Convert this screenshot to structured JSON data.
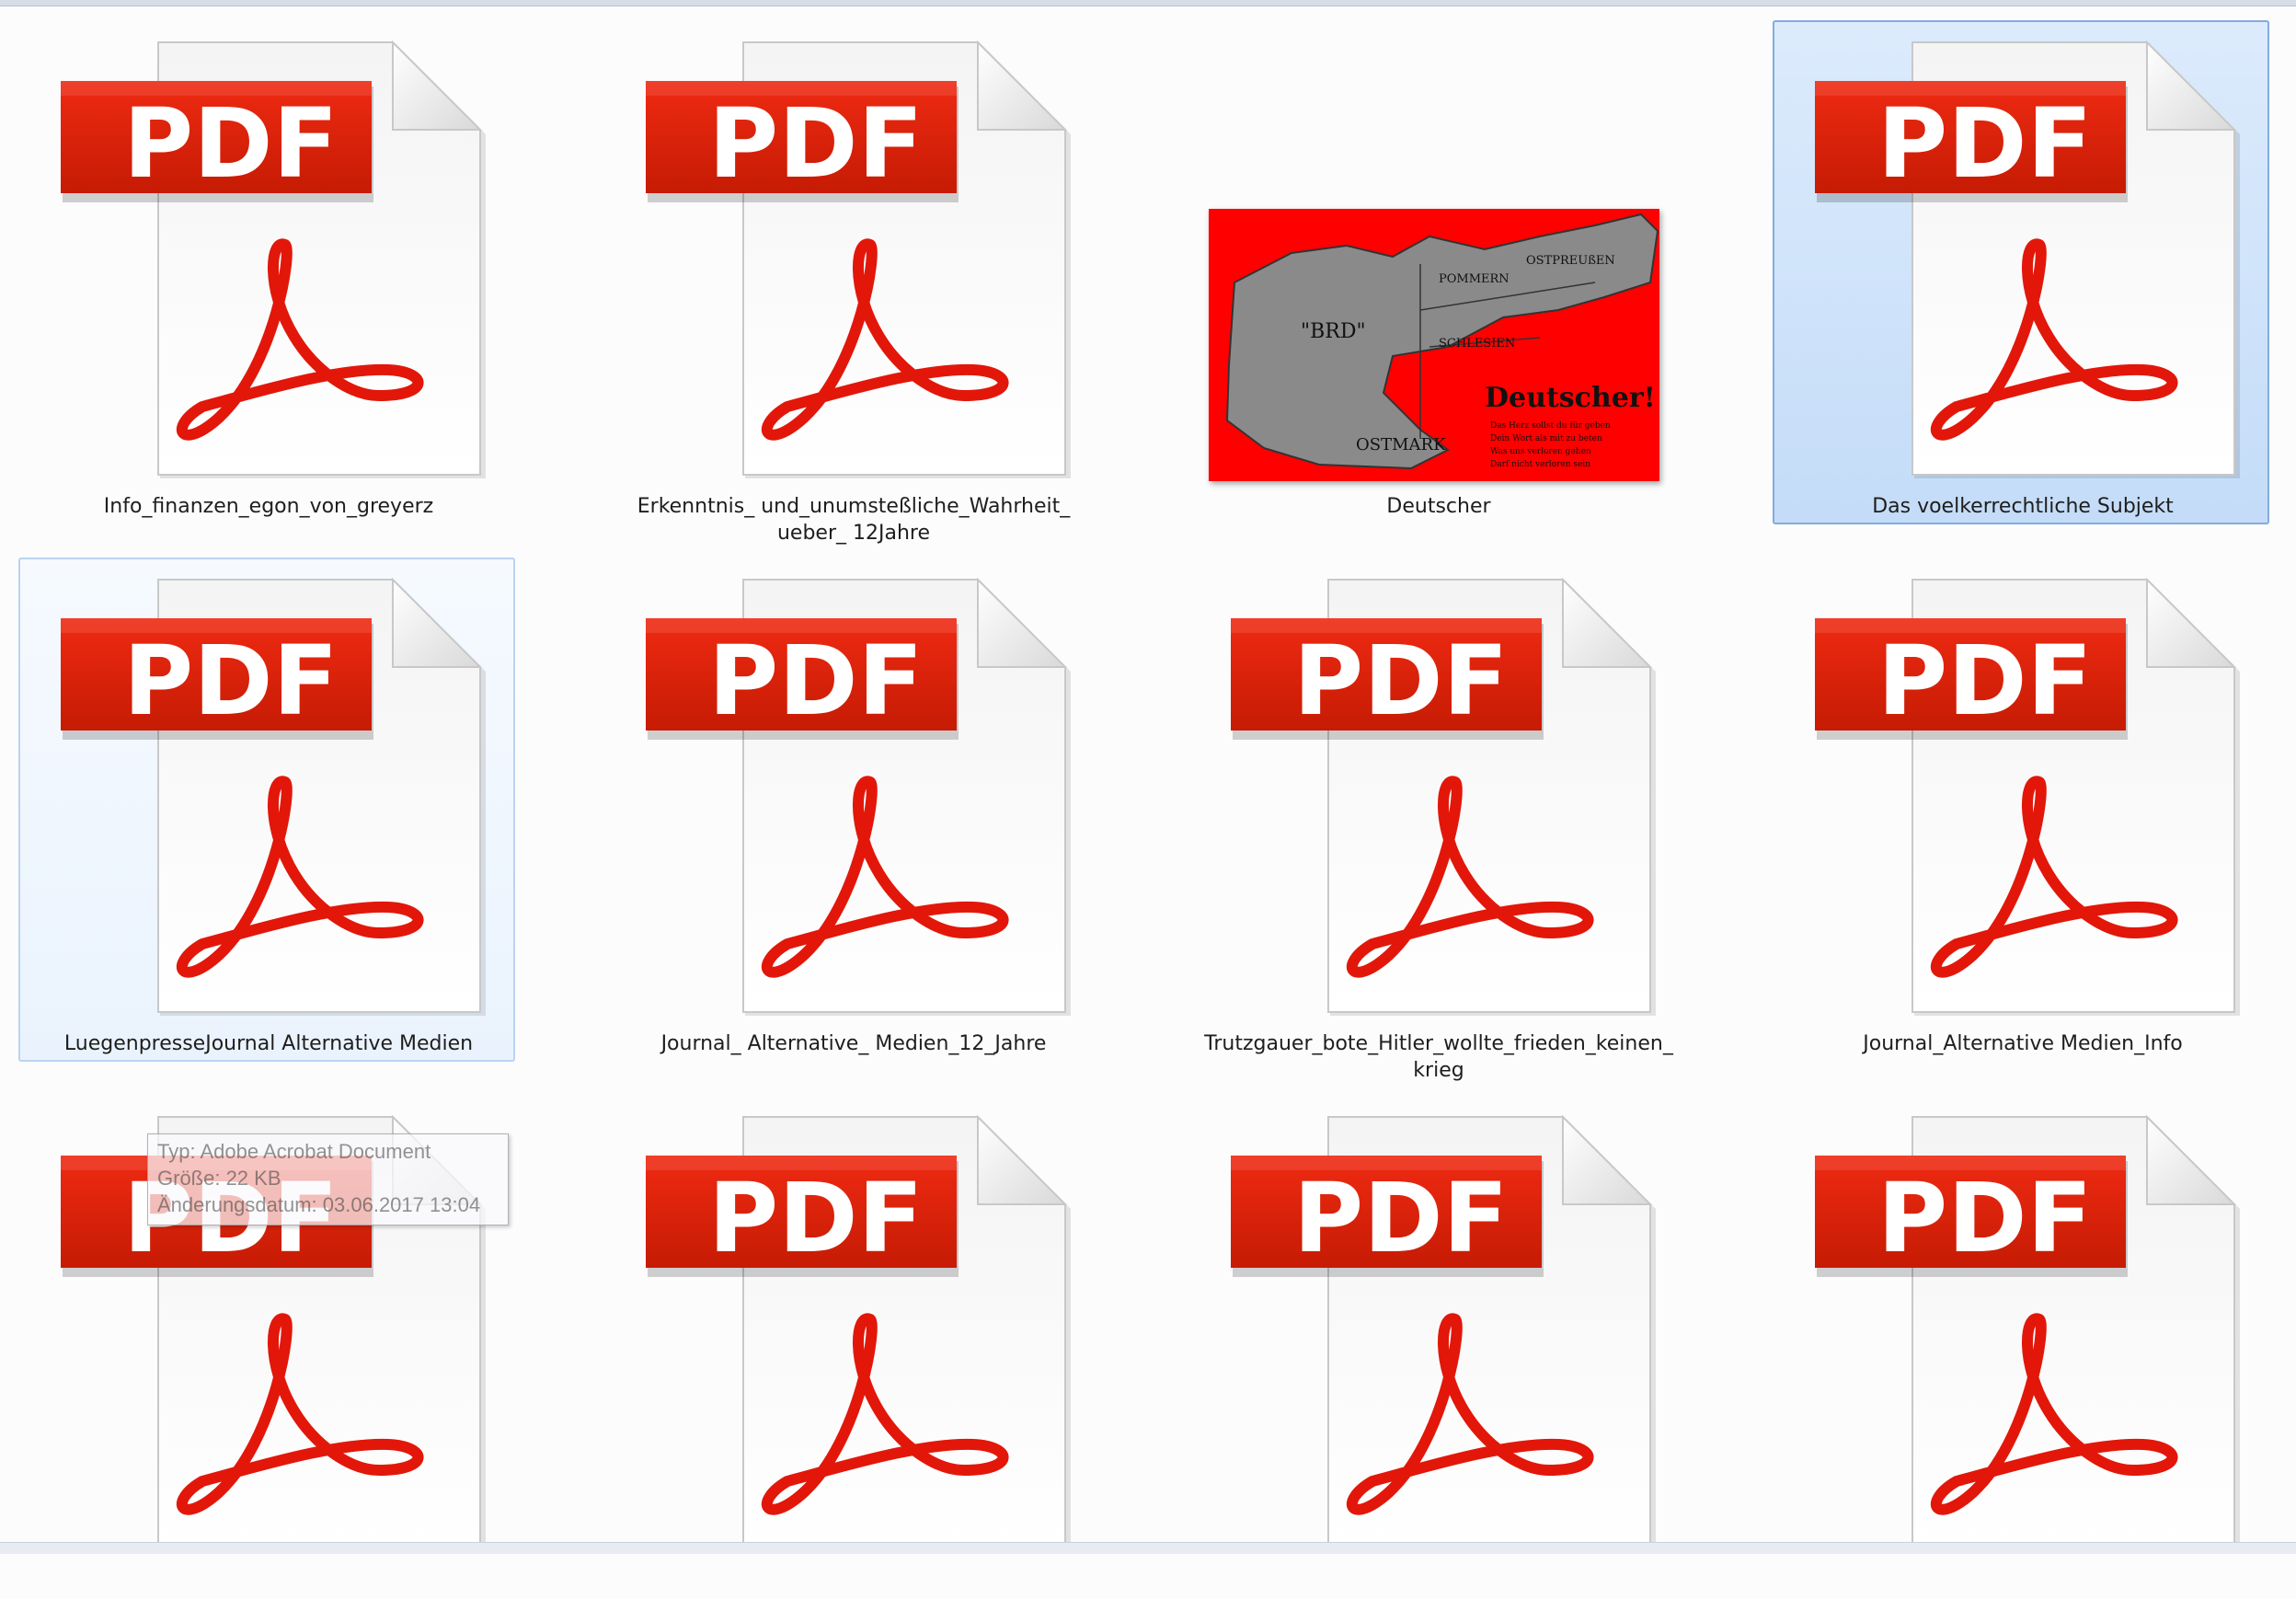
{
  "files": [
    {
      "name": "Info_finanzen_egon_von_greyerz",
      "type": "pdf",
      "state": "normal"
    },
    {
      "name": "Erkenntnis_ und_unumsteßliche_Wahrheit_ ueber_ 12Jahre",
      "type": "pdf",
      "state": "normal"
    },
    {
      "name": "Deutscher",
      "type": "image",
      "state": "normal"
    },
    {
      "name": "Das voelkerrechtliche Subjekt",
      "type": "pdf",
      "state": "selected"
    },
    {
      "name": "LuegenpresseJournal Alternative Medien",
      "type": "pdf",
      "state": "hover"
    },
    {
      "name": "Journal_ Alternative_ Medien_12_Jahre",
      "type": "pdf",
      "state": "normal"
    },
    {
      "name": "Trutzgauer_bote_Hitler_wollte_frieden_keinen_krieg",
      "type": "pdf",
      "state": "normal"
    },
    {
      "name": "Journal_Alternative Medien_Info",
      "type": "pdf",
      "state": "normal"
    },
    {
      "name": "",
      "type": "pdf",
      "state": "normal"
    },
    {
      "name": "",
      "type": "pdf",
      "state": "normal"
    },
    {
      "name": "",
      "type": "pdf",
      "state": "normal"
    },
    {
      "name": "",
      "type": "pdf",
      "state": "normal"
    }
  ],
  "pdf_badge_text": "PDF",
  "image_thumbnail": {
    "title": "Deutscher!",
    "labels": [
      "\"BRD\"",
      "POMMERN",
      "OSTPREUßEN",
      "SCHLESIEN",
      "OSTMARK"
    ],
    "caption_lines": [
      "Das Herz sollst du für geben",
      "Dein Wort als mit zu beten",
      "Was uns verloren gehen",
      "Darf nicht verloren sein"
    ]
  },
  "tooltip": {
    "type_line": "Typ: Adobe Acrobat Document",
    "size_line": "Größe: 22 KB",
    "date_line": "Änderungsdatum: 03.06.2017 13:04"
  },
  "colors": {
    "pdf_red": "#d81e05",
    "selected_bg": "#cfe3fb",
    "thumb_red": "#ff0000",
    "map_gray": "#8c8c8c"
  }
}
